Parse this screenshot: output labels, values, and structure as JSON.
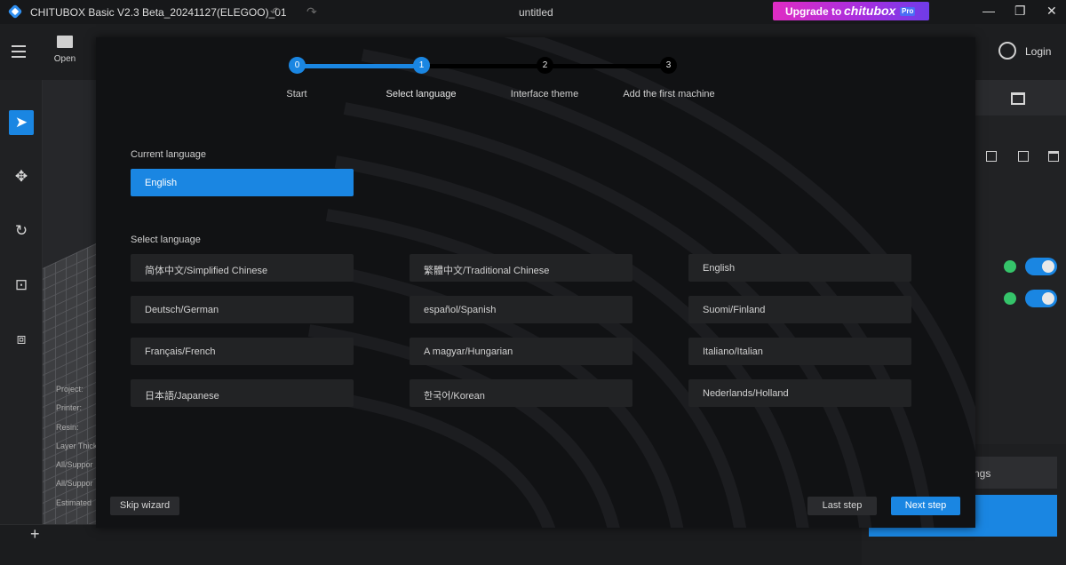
{
  "titlebar": {
    "app_title": "CHITUBOX Basic V2.3 Beta_20241127(ELEGOO)_01",
    "doc_title": "untitled",
    "upgrade_label": "Upgrade to",
    "upgrade_brand": "chitubox",
    "upgrade_badge": "Pro",
    "undo_icon": "↶",
    "redo_icon": "↷",
    "min_icon": "—",
    "max_icon": "❐",
    "close_icon": "✕"
  },
  "toolbar": {
    "open_label": "Open",
    "login_label": "Login"
  },
  "left_tools": {
    "select_icon": "➤",
    "move_icon": "✥",
    "rotate_icon": "↻",
    "scale_icon": "⊡",
    "mirror_icon": "⧈"
  },
  "viewport": {
    "info_labels": [
      "Project:",
      "Printer:",
      "Resin:",
      "Layer Thick",
      "All/Suppor",
      "All/Suppor",
      "Estimated"
    ]
  },
  "bottom_bar": {
    "add_icon": "+"
  },
  "right_panel": {
    "settings_label": "ngs"
  },
  "wizard": {
    "steps": [
      {
        "number": "0",
        "label": "Start"
      },
      {
        "number": "1",
        "label": "Select language"
      },
      {
        "number": "2",
        "label": "Interface theme"
      },
      {
        "number": "3",
        "label": "Add the first machine"
      }
    ],
    "current_step_index": 1,
    "current_language_title": "Current language",
    "current_language_value": "English",
    "select_language_title": "Select language",
    "languages": [
      "简体中文/Simplified Chinese",
      "繁體中文/Traditional Chinese",
      "English",
      "Deutsch/German",
      "español/Spanish",
      "Suomi/Finland",
      "Français/French",
      "A magyar/Hungarian",
      "Italiano/Italian",
      "日本語/Japanese",
      "한국어/Korean",
      "Nederlands/Holland"
    ],
    "skip_label": "Skip wizard",
    "last_label": "Last step",
    "next_label": "Next step"
  },
  "colors": {
    "accent": "#1a86e2",
    "wizard_bg": "#111214",
    "status_green": "#35c46a"
  }
}
